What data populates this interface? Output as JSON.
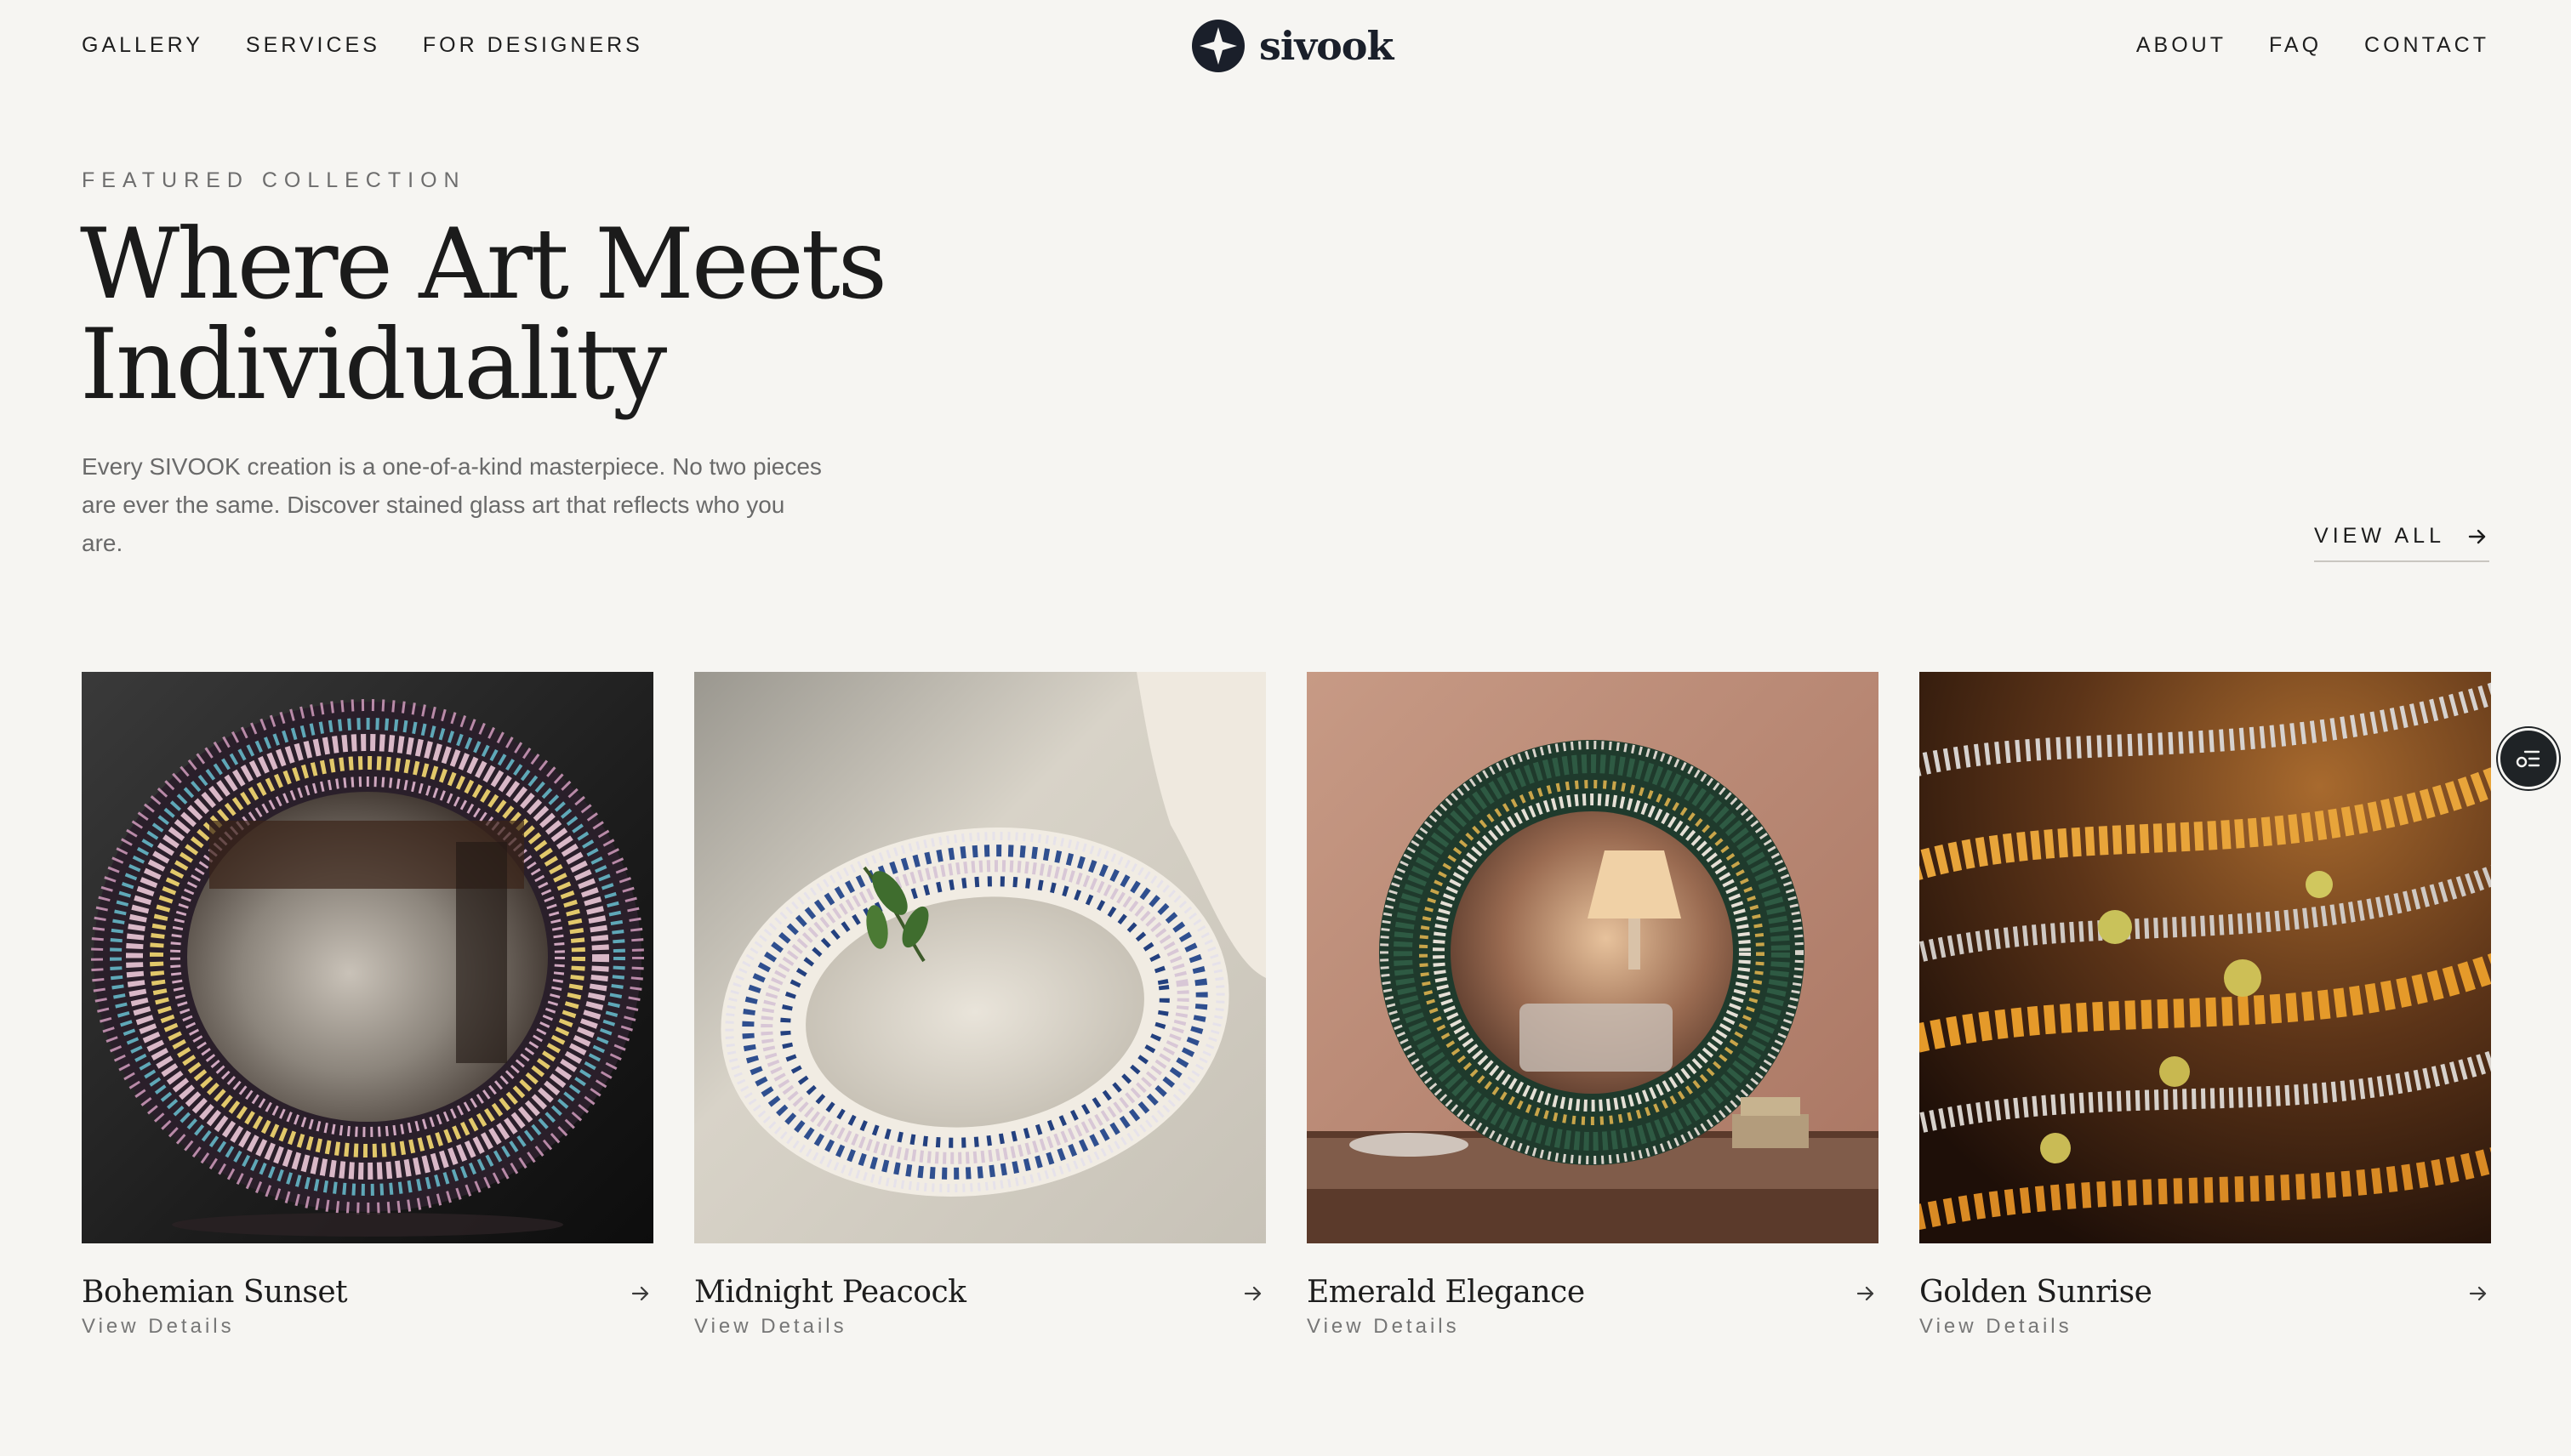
{
  "nav": {
    "left": [
      "GALLERY",
      "SERVICES",
      "FOR DESIGNERS"
    ],
    "right": [
      "ABOUT",
      "FAQ",
      "CONTACT"
    ]
  },
  "brand": {
    "name": "sivook",
    "icon": "compass-star-icon"
  },
  "hero": {
    "eyebrow": "FEATURED COLLECTION",
    "headline_line1": "Where Art Meets",
    "headline_line2": "Individuality",
    "description": "Every SIVOOK creation is a one-of-a-kind masterpiece. No two pieces are ever the same. Discover stained glass art that reflects who you are.",
    "view_all_label": "VIEW ALL",
    "view_all_icon": "arrow-right-icon"
  },
  "products": [
    {
      "title": "Bohemian Sunset",
      "link_label": "View Details",
      "icon": "arrow-right-icon"
    },
    {
      "title": "Midnight Peacock",
      "link_label": "View Details",
      "icon": "arrow-right-icon"
    },
    {
      "title": "Emerald Elegance",
      "link_label": "View Details",
      "icon": "arrow-right-icon"
    },
    {
      "title": "Golden Sunrise",
      "link_label": "View Details",
      "icon": "arrow-right-icon"
    }
  ],
  "floating_widget": {
    "icon": "settings-list-icon"
  },
  "colors": {
    "background": "#f6f5f2",
    "text": "#1c1c1c",
    "muted": "#6a6a6a",
    "brand": "#1a1f2a"
  }
}
